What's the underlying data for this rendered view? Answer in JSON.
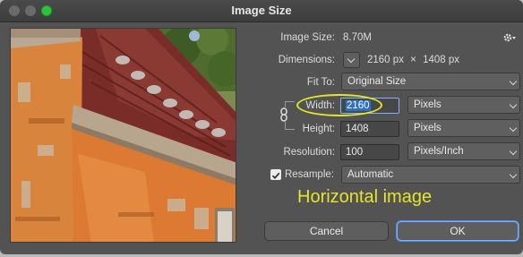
{
  "window": {
    "title": "Image Size"
  },
  "image_size": {
    "label": "Image Size:",
    "value": "8.70M"
  },
  "dimensions": {
    "label": "Dimensions:",
    "width": "2160",
    "height": "1408",
    "unit": "px",
    "times": "×"
  },
  "fit_to": {
    "label": "Fit To:",
    "value": "Original Size"
  },
  "width": {
    "label": "Width:",
    "value": "2160",
    "unit": "Pixels"
  },
  "height": {
    "label": "Height:",
    "value": "1408",
    "unit": "Pixels"
  },
  "resolution": {
    "label": "Resolution:",
    "value": "100",
    "unit": "Pixels/Inch"
  },
  "resample": {
    "label": "Resample:",
    "value": "Automatic",
    "checked": true
  },
  "annotation": "Horizontal image",
  "buttons": {
    "cancel": "Cancel",
    "ok": "OK"
  },
  "icons": {
    "settings": "gear-icon",
    "link": "chain-link-icon",
    "checkbox": "checkmark-icon",
    "dropdown": "chevron-down-icon"
  },
  "colors": {
    "annotation": "#e6e42a",
    "selection": "#2f6fc8",
    "ok_border": "#7fb2ff"
  }
}
